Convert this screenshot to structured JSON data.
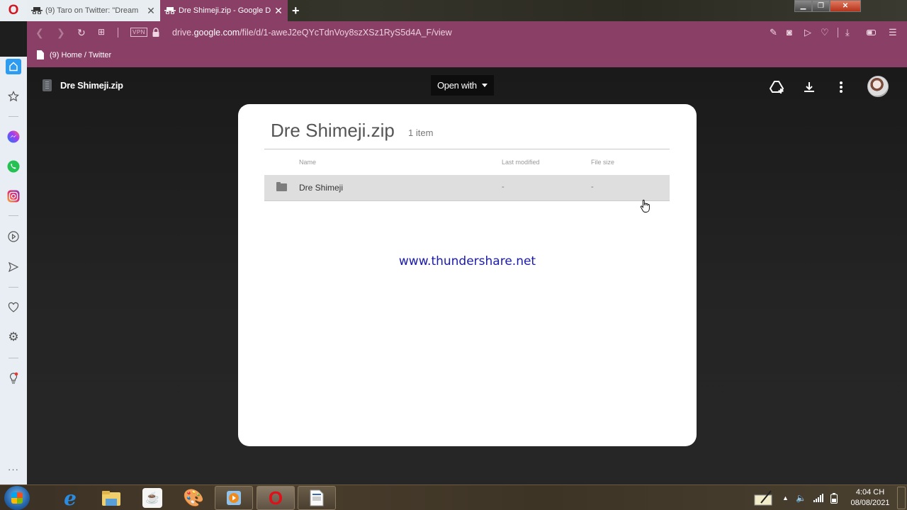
{
  "browser": {
    "tabs": [
      {
        "title": "(9) Taro on Twitter: \"Dream",
        "active": false,
        "icon": "incognito-icon"
      },
      {
        "title": "Dre Shimeji.zip - Google Dr",
        "active": true,
        "icon": "incognito-icon"
      }
    ],
    "new_tab_label": "+",
    "url_prefix": "drive.",
    "url_domain": "google.com",
    "url_path": "/file/d/1-aweJ2eQYcTdnVoy8szXSz1RyS5d4A_F/view",
    "vpn_label": "VPN",
    "bookmarks": [
      {
        "label": "(9) Home / Twitter"
      }
    ],
    "accent_color": "#8a3f66"
  },
  "sidebar": {
    "items": [
      "home",
      "bookmarks",
      "messenger",
      "whatsapp",
      "instagram",
      "player",
      "send",
      "favorites",
      "settings",
      "tips"
    ],
    "more_label": "···"
  },
  "drive": {
    "file_name": "Dre Shimeji.zip",
    "open_with_label": "Open with",
    "archive": {
      "title": "Dre Shimeji.zip",
      "count": "1 item",
      "columns": [
        "Name",
        "Last modified",
        "File size"
      ],
      "rows": [
        {
          "name": "Dre Shimeji",
          "modified": "-",
          "size": "-",
          "type": "folder"
        }
      ]
    },
    "watermark": "www.thundershare.net"
  },
  "taskbar": {
    "apps": [
      "internet-explorer",
      "file-explorer",
      "java",
      "paint",
      "media-player",
      "opera",
      "document"
    ],
    "clock_time": "4:04 CH",
    "clock_date": "08/08/2021"
  }
}
